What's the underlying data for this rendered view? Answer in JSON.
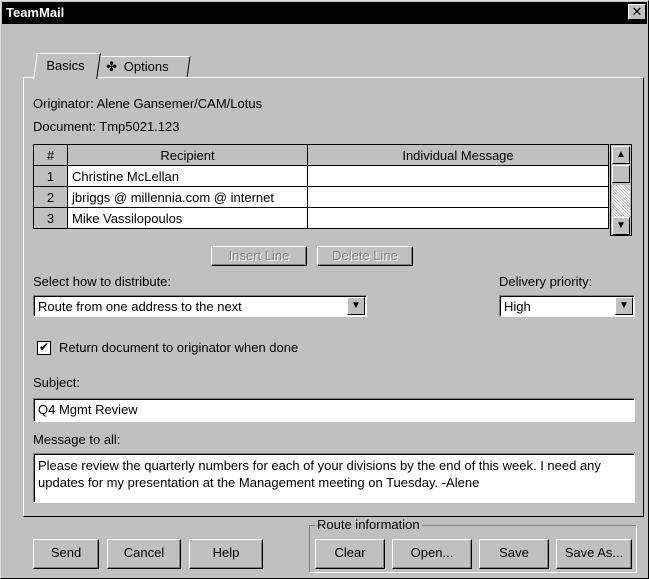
{
  "window": {
    "title": "TeamMail",
    "close_glyph": "✕"
  },
  "tabs": [
    {
      "label": "Basics",
      "active": true
    },
    {
      "label": "Options",
      "icon": "options-icon",
      "active": false
    }
  ],
  "info": {
    "originator_label": "Originator:",
    "originator_value": "Alene Gansemer/CAM/Lotus",
    "document_label": "Document:",
    "document_value": "Tmp5021.123"
  },
  "recipients_table": {
    "columns": [
      "#",
      "Recipient",
      "Individual Message"
    ],
    "rows": [
      {
        "num": "1",
        "recipient": "Christine McLellan",
        "message": ""
      },
      {
        "num": "2",
        "recipient": "jbriggs @ millennia.com @ internet",
        "message": ""
      },
      {
        "num": "3",
        "recipient": "Mike Vassilopoulos",
        "message": ""
      }
    ]
  },
  "line_buttons": {
    "insert": "Insert Line",
    "delete": "Delete Line"
  },
  "distribution": {
    "label": "Select how to distribute:",
    "value": "Route from one address to the next"
  },
  "priority": {
    "label": "Delivery priority:",
    "value": "High"
  },
  "return_checkbox": {
    "label": "Return document to originator when done",
    "checked": true,
    "mark": "✔"
  },
  "subject": {
    "label": "Subject:",
    "value": "Q4 Mgmt Review"
  },
  "message": {
    "label": "Message to all:",
    "value": "Please review the quarterly numbers for each of your divisions by the end of this week.  I need any updates for my presentation at the Management meeting on Tuesday.  -Alene"
  },
  "footer_buttons": {
    "send": "Send",
    "cancel": "Cancel",
    "help": "Help"
  },
  "route_info": {
    "label": "Route information",
    "clear": "Clear",
    "open": "Open...",
    "save": "Save",
    "save_as": "Save As..."
  },
  "scroll_glyphs": {
    "up": "▲",
    "down": "▼"
  }
}
